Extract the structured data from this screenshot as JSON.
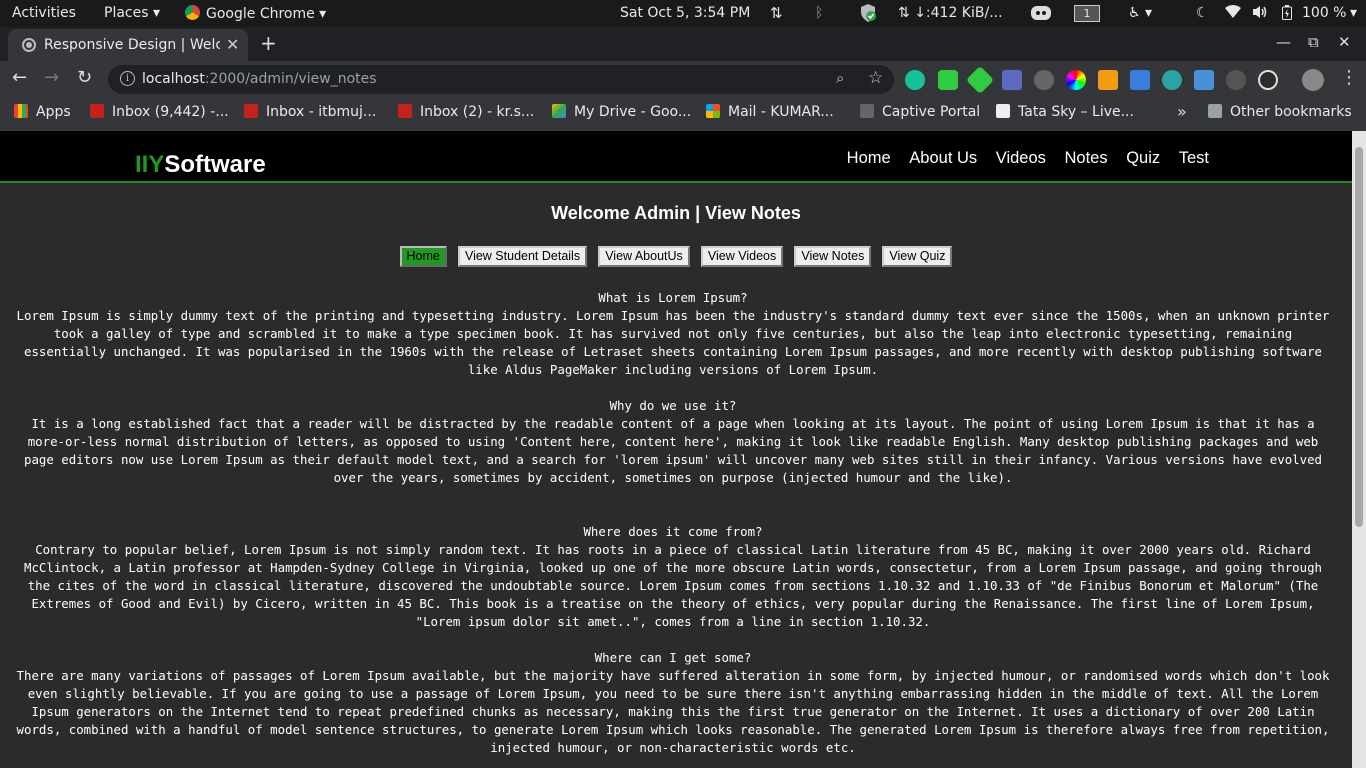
{
  "system_bar": {
    "activities": "Activities",
    "places": "Places",
    "app": "Google Chrome",
    "clock": "Sat Oct  5,  3:54 PM",
    "net_speed": "↓:412 KiB/...",
    "workspace": "1",
    "battery": "100 %"
  },
  "browser": {
    "tab_title": "Responsive Design | Welcome",
    "url_host": "localhost",
    "url_path": ":2000/admin/view_notes",
    "bookmarks": [
      "Apps",
      "Inbox (9,442) -...",
      "Inbox - itbmuj...",
      "Inbox (2) - kr.s...",
      "My Drive - Goo...",
      "Mail - KUMAR...",
      "Captive Portal",
      "Tata Sky – Live...",
      "»",
      "Other bookmarks"
    ]
  },
  "site": {
    "brand_accent": "IIY",
    "brand_rest": "Software",
    "nav": [
      "Home",
      "About Us",
      "Videos",
      "Notes",
      "Quiz",
      "Test"
    ],
    "page_title": "Welcome Admin | View Notes",
    "admin_buttons": [
      "Home",
      "View Student Details",
      "View AboutUs",
      "View Videos",
      "View Notes",
      "View Quiz"
    ],
    "notes": [
      {
        "question": "What is Lorem Ipsum?",
        "body": "Lorem Ipsum is simply dummy text of the printing and typesetting industry. Lorem Ipsum has been the industry's standard dummy text ever since the 1500s, when an unknown printer took a galley of type and scrambled it to make a type specimen book. It has survived not only five centuries, but also the leap into electronic typesetting, remaining essentially unchanged. It was popularised in the 1960s with the release of Letraset sheets containing Lorem Ipsum passages, and more recently with desktop publishing software like Aldus PageMaker including versions of Lorem Ipsum."
      },
      {
        "question": "Why do we use it?",
        "body": "It is a long established fact that a reader will be distracted by the readable content of a page when looking at its layout. The point of using Lorem Ipsum is that it has a more-or-less normal distribution of letters, as opposed to using 'Content here, content here', making it look like readable English. Many desktop publishing packages and web page editors now use Lorem Ipsum as their default model text, and a search for 'lorem ipsum' will uncover many web sites still in their infancy. Various versions have evolved over the years, sometimes by accident, sometimes on purpose (injected humour and the like)."
      },
      {
        "question": "Where does it come from?",
        "body": "Contrary to popular belief, Lorem Ipsum is not simply random text. It has roots in a piece of classical Latin literature from 45 BC, making it over 2000 years old. Richard McClintock, a Latin professor at Hampden-Sydney College in Virginia, looked up one of the more obscure Latin words, consectetur, from a Lorem Ipsum passage, and going through the cites of the word in classical literature, discovered the undoubtable source. Lorem Ipsum comes from sections 1.10.32 and 1.10.33 of \"de Finibus Bonorum et Malorum\" (The Extremes of Good and Evil) by Cicero, written in 45 BC. This book is a treatise on the theory of ethics, very popular during the Renaissance. The first line of Lorem Ipsum, \"Lorem ipsum dolor sit amet..\", comes from a line in section 1.10.32."
      },
      {
        "question": "Where can I get some?",
        "body": "There are many variations of passages of Lorem Ipsum available, but the majority have suffered alteration in some form, by injected humour, or randomised words which don't look even slightly believable. If you are going to use a passage of Lorem Ipsum, you need to be sure there isn't anything embarrassing hidden in the middle of text. All the Lorem Ipsum generators on the Internet tend to repeat predefined chunks as necessary, making this the first true generator on the Internet. It uses a dictionary of over 200 Latin words, combined with a handful of model sentence structures, to generate Lorem Ipsum which looks reasonable. The generated Lorem Ipsum is therefore always free from repetition, injected humour, or non-characteristic words etc."
      }
    ]
  },
  "colors": {
    "accent": "#1f9a1f",
    "page_bg": "#2b2b2b",
    "nav_bg": "#000000"
  }
}
